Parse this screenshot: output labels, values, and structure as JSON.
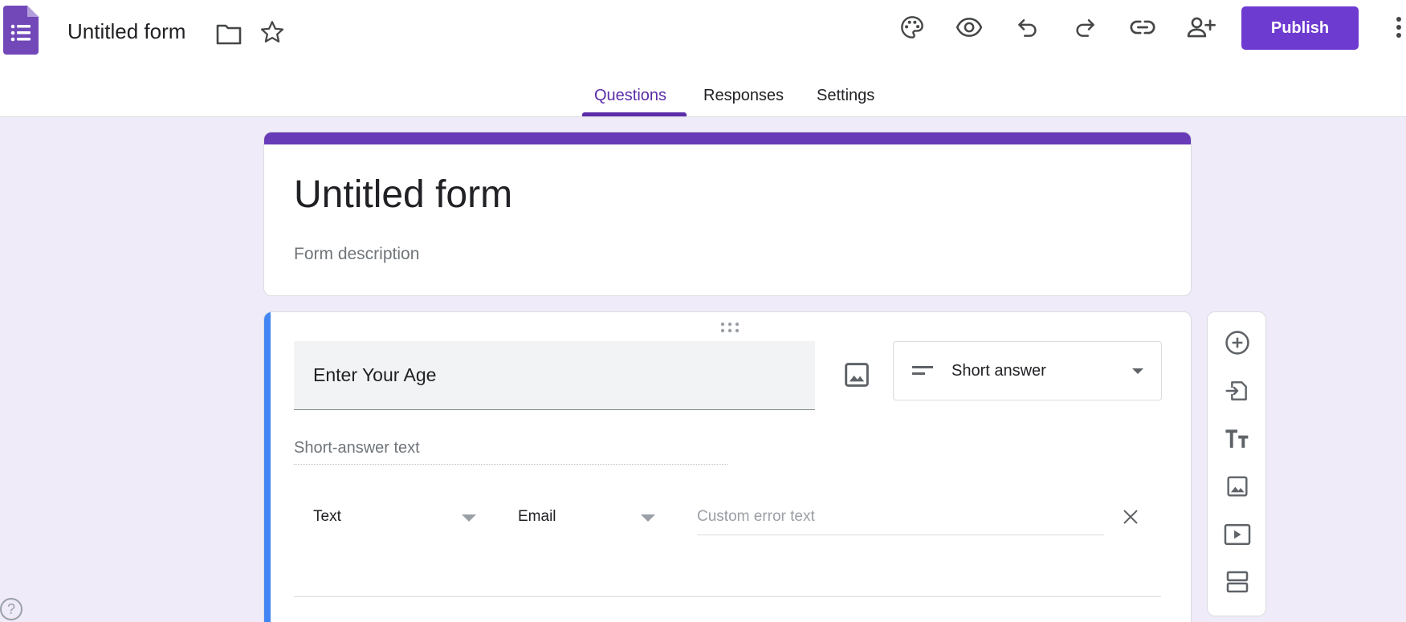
{
  "app": {
    "doc_title": "Untitled form",
    "logo_icon": "forms-logo-icon",
    "accent_color": "#673ab7",
    "publish_color": "#6e3bd1"
  },
  "toolbar": {
    "icons": [
      "palette-icon",
      "preview-eye-icon",
      "undo-icon",
      "redo-icon",
      "link-icon",
      "add-collaborator-icon",
      "more-vert-icon"
    ],
    "publish_label": "Publish"
  },
  "tabs": [
    {
      "label": "Questions",
      "active": true
    },
    {
      "label": "Responses",
      "active": false
    },
    {
      "label": "Settings",
      "active": false
    }
  ],
  "header_card": {
    "title": "Untitled form",
    "description_placeholder": "Form description"
  },
  "question": {
    "title": "Enter Your Age",
    "type_label": "Short answer",
    "answer_placeholder": "Short-answer text",
    "validation": {
      "type": "Text",
      "condition": "Email",
      "error_placeholder": "Custom error text"
    }
  },
  "side_tools": [
    "add-question-icon",
    "import-questions-icon",
    "add-title-icon",
    "add-image-icon",
    "add-video-icon",
    "add-section-icon"
  ],
  "help_label": "?"
}
